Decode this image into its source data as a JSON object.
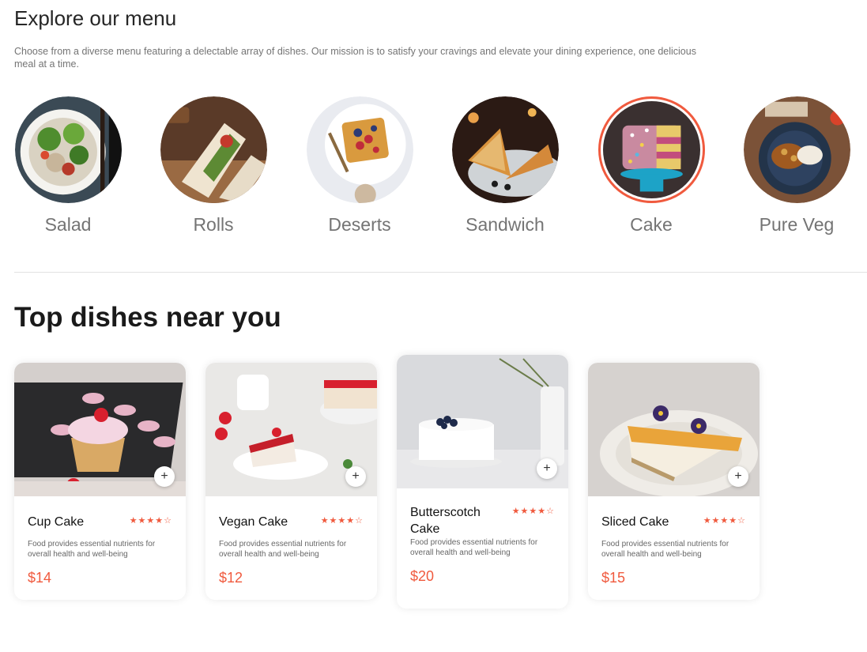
{
  "menu": {
    "title": "Explore our menu",
    "description": "Choose from a diverse menu featuring a delectable array of dishes. Our mission is to satisfy your cravings and elevate your dining experience, one delicious meal at a time.",
    "categories": [
      {
        "label": "Salad",
        "icon": "salad-image",
        "active": false
      },
      {
        "label": "Rolls",
        "icon": "rolls-image",
        "active": false
      },
      {
        "label": "Deserts",
        "icon": "deserts-image",
        "active": false
      },
      {
        "label": "Sandwich",
        "icon": "sandwich-image",
        "active": false
      },
      {
        "label": "Cake",
        "icon": "cake-image",
        "active": true
      },
      {
        "label": "Pure Veg",
        "icon": "pure-veg-image",
        "active": false
      }
    ]
  },
  "dishes": {
    "title": "Top dishes near you",
    "items": [
      {
        "name": "Cup Cake",
        "rating": "★★★★☆",
        "description": "Food provides essential nutrients for overall health and well-being",
        "price": "$14",
        "add": "+"
      },
      {
        "name": "Vegan Cake",
        "rating": "★★★★☆",
        "description": "Food provides essential nutrients for overall health and well-being",
        "price": "$12",
        "add": "+"
      },
      {
        "name": "Butterscotch Cake",
        "rating": "★★★★☆",
        "description": "Food provides essential nutrients for overall health and well-being",
        "price": "$20",
        "add": "+"
      },
      {
        "name": "Sliced Cake",
        "rating": "★★★★☆",
        "description": "Food provides essential nutrients for overall health and well-being",
        "price": "$15",
        "add": "+"
      }
    ]
  },
  "colors": {
    "accent": "#f05a3e",
    "text": "#262626",
    "muted": "#747474"
  }
}
